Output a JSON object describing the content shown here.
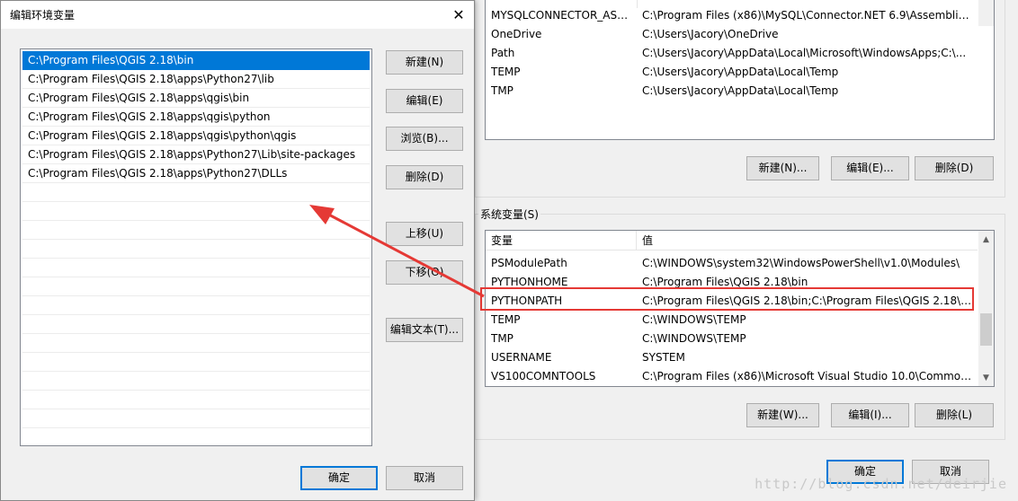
{
  "dialog": {
    "title": "编辑环境变量",
    "close_glyph": "✕",
    "paths": [
      "C:\\Program Files\\QGIS 2.18\\bin",
      "C:\\Program Files\\QGIS 2.18\\apps\\Python27\\lib",
      "C:\\Program Files\\QGIS 2.18\\apps\\qgis\\bin",
      "C:\\Program Files\\QGIS 2.18\\apps\\qgis\\python",
      "C:\\Program Files\\QGIS 2.18\\apps\\qgis\\python\\qgis",
      "C:\\Program Files\\QGIS 2.18\\apps\\Python27\\Lib\\site-packages",
      "C:\\Program Files\\QGIS 2.18\\apps\\Python27\\DLLs"
    ],
    "buttons": {
      "new": "新建(N)",
      "edit": "编辑(E)",
      "browse": "浏览(B)...",
      "delete": "删除(D)",
      "move_up": "上移(U)",
      "move_down": "下移(O)",
      "edit_text": "编辑文本(T)...",
      "ok": "确定",
      "cancel": "取消"
    }
  },
  "user_vars": {
    "rows": [
      {
        "name": "MYSQLCONNECTOR_ASS...",
        "value": "C:\\Program Files (x86)\\MySQL\\Connector.NET 6.9\\Assemblies\\..."
      },
      {
        "name": "OneDrive",
        "value": "C:\\Users\\Jacory\\OneDrive"
      },
      {
        "name": "Path",
        "value": "C:\\Users\\Jacory\\AppData\\Local\\Microsoft\\WindowsApps;C:\\..."
      },
      {
        "name": "TEMP",
        "value": "C:\\Users\\Jacory\\AppData\\Local\\Temp"
      },
      {
        "name": "TMP",
        "value": "C:\\Users\\Jacory\\AppData\\Local\\Temp"
      }
    ],
    "buttons": {
      "new": "新建(N)...",
      "edit": "编辑(E)...",
      "delete": "删除(D)"
    }
  },
  "system_vars": {
    "group_label": "系统变量(S)",
    "header": {
      "name": "变量",
      "value": "值"
    },
    "rows": [
      {
        "name": "PSModulePath",
        "value": "C:\\WINDOWS\\system32\\WindowsPowerShell\\v1.0\\Modules\\"
      },
      {
        "name": "PYTHONHOME",
        "value": "C:\\Program Files\\QGIS 2.18\\bin"
      },
      {
        "name": "PYTHONPATH",
        "value": "C:\\Program Files\\QGIS 2.18\\bin;C:\\Program Files\\QGIS 2.18\\a..."
      },
      {
        "name": "TEMP",
        "value": "C:\\WINDOWS\\TEMP"
      },
      {
        "name": "TMP",
        "value": "C:\\WINDOWS\\TEMP"
      },
      {
        "name": "USERNAME",
        "value": "SYSTEM"
      },
      {
        "name": "VS100COMNTOOLS",
        "value": "C:\\Program Files (x86)\\Microsoft Visual Studio 10.0\\Common..."
      }
    ],
    "buttons": {
      "new": "新建(W)...",
      "edit": "编辑(I)...",
      "delete": "删除(L)"
    }
  },
  "parent_buttons": {
    "ok": "确定",
    "cancel": "取消"
  },
  "watermark": "http://blog.csdn.net/deirjie",
  "colors": {
    "selection": "#0078d7",
    "highlight": "#e53935"
  }
}
